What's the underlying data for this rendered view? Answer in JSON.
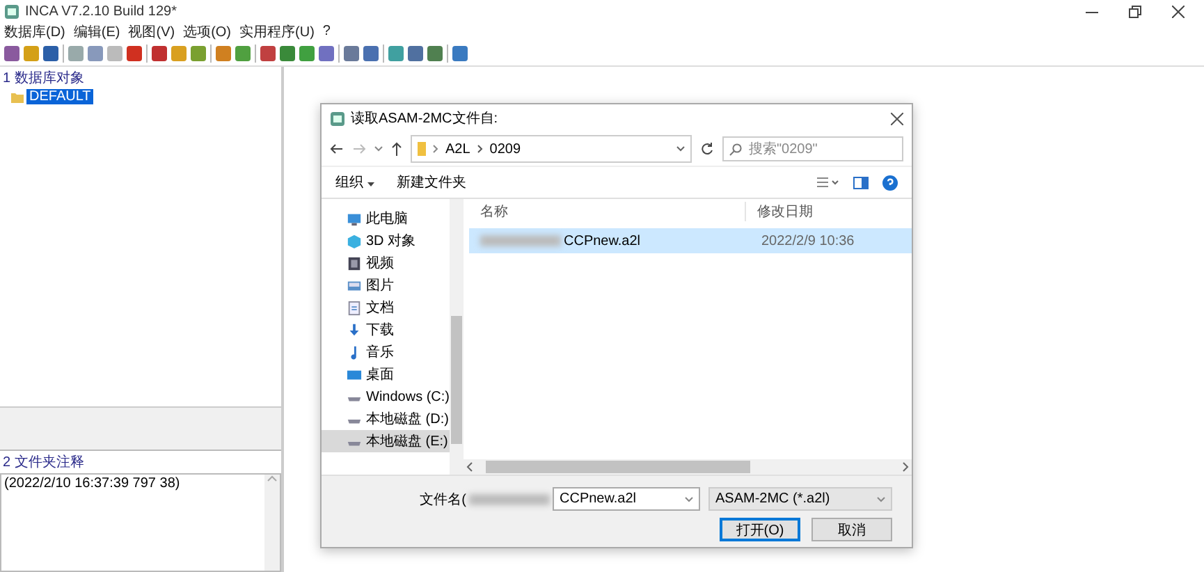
{
  "window": {
    "title": "INCA V7.2.10 Build 129*"
  },
  "menu": [
    "数据库(D)",
    "编辑(E)",
    "视图(V)",
    "选项(O)",
    "实用程序(U)",
    "?"
  ],
  "left_panel": {
    "objects_header": "1 数据库对象",
    "tree": [
      {
        "label": "DEFAULT",
        "selected": true
      }
    ],
    "comments_header": "2 文件夹注释",
    "comments_text": "(2022/2/10 16:37:39 797 38)"
  },
  "dialog": {
    "title": "读取ASAM-2MC文件自:",
    "breadcrumb": [
      "A2L",
      "0209"
    ],
    "search": {
      "placeholder": "搜索\"0209\""
    },
    "organize": "组织",
    "new_folder": "新建文件夹",
    "nav_items": [
      {
        "label": "此电脑",
        "kind": "pc",
        "selected": false
      },
      {
        "label": "3D 对象",
        "kind": "cube",
        "selected": false
      },
      {
        "label": "视频",
        "kind": "film",
        "selected": false
      },
      {
        "label": "图片",
        "kind": "image",
        "selected": false
      },
      {
        "label": "文档",
        "kind": "doc",
        "selected": false
      },
      {
        "label": "下载",
        "kind": "download",
        "selected": false
      },
      {
        "label": "音乐",
        "kind": "music",
        "selected": false
      },
      {
        "label": "桌面",
        "kind": "desktop",
        "selected": false
      },
      {
        "label": "Windows (C:)",
        "kind": "drive",
        "selected": false
      },
      {
        "label": "本地磁盘 (D:)",
        "kind": "drive",
        "selected": false
      },
      {
        "label": "本地磁盘 (E:)",
        "kind": "drive",
        "selected": true
      }
    ],
    "columns": [
      "名称",
      "修改日期"
    ],
    "files": [
      {
        "name": "CCPnew.a2l",
        "date": "2022/2/9 10:36",
        "selected": true
      }
    ],
    "filename_label": "文件名(",
    "filename_value": "CCPnew.a2l",
    "filetype": "ASAM-2MC (*.a2l)",
    "buttons": [
      {
        "label": "打开(O)",
        "default": true
      },
      {
        "label": "取消",
        "default": false
      }
    ]
  }
}
